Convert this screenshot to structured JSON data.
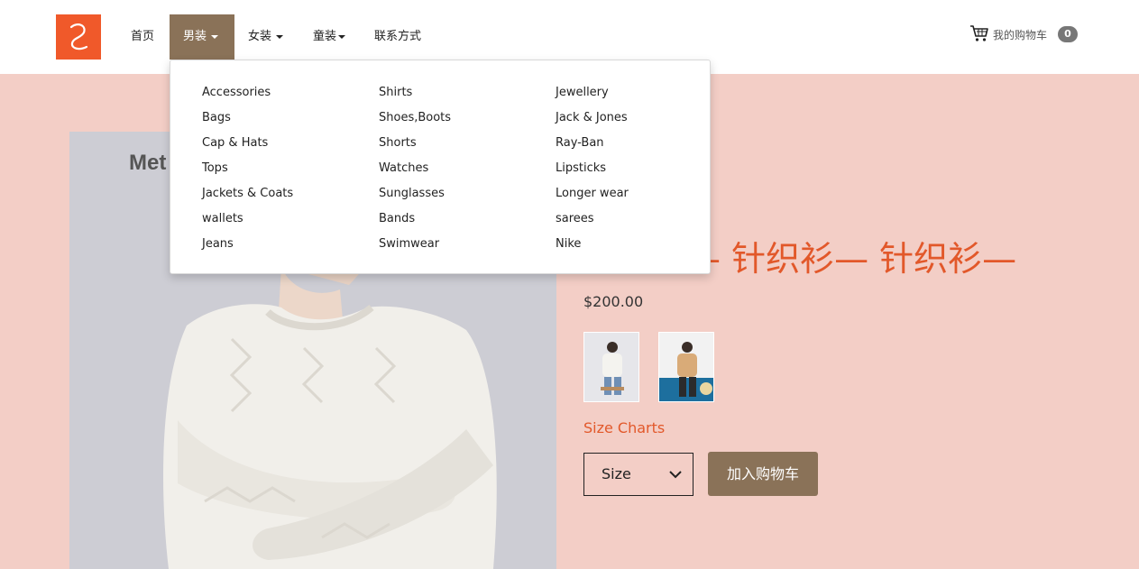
{
  "header": {
    "nav": [
      {
        "label": "首页",
        "has_caret": false,
        "active": false
      },
      {
        "label": "男装",
        "has_caret": true,
        "active": true
      },
      {
        "label": "女装",
        "has_caret": true,
        "active": false
      },
      {
        "label": "童装",
        "has_caret": true,
        "active": false
      },
      {
        "label": "联系方式",
        "has_caret": false,
        "active": false
      }
    ],
    "cart": {
      "label": "我的购物车",
      "count": "0",
      "icon": "shopping-cart-icon"
    },
    "logo_icon": "brand-logo"
  },
  "dropdown": {
    "columns": [
      [
        "Accessories",
        "Bags",
        "Cap & Hats",
        "Tops",
        "Jackets & Coats",
        "wallets",
        "Jeans"
      ],
      [
        "Shirts",
        "Shoes,Boots",
        "Shorts",
        "Watches",
        "Sunglasses",
        "Bands",
        "Swimwear"
      ],
      [
        "Jewellery",
        "Jack & Jones",
        "Ray-Ban",
        "Lipsticks",
        "Longer wear",
        "sarees",
        "Nike"
      ]
    ]
  },
  "product": {
    "title": "针织衫— 针织衫— 针织衫—",
    "price": "$200.00",
    "image_brand_text": "Met",
    "size_charts": "Size Charts",
    "size_select": {
      "selected": "Size",
      "icon": "chevron-down-icon"
    },
    "add_to_cart": "加入购物车"
  },
  "colors": {
    "accent": "#f0592a",
    "nav_active": "#8a7258",
    "page_bg": "#f3cec6",
    "title": "#e2582a"
  }
}
